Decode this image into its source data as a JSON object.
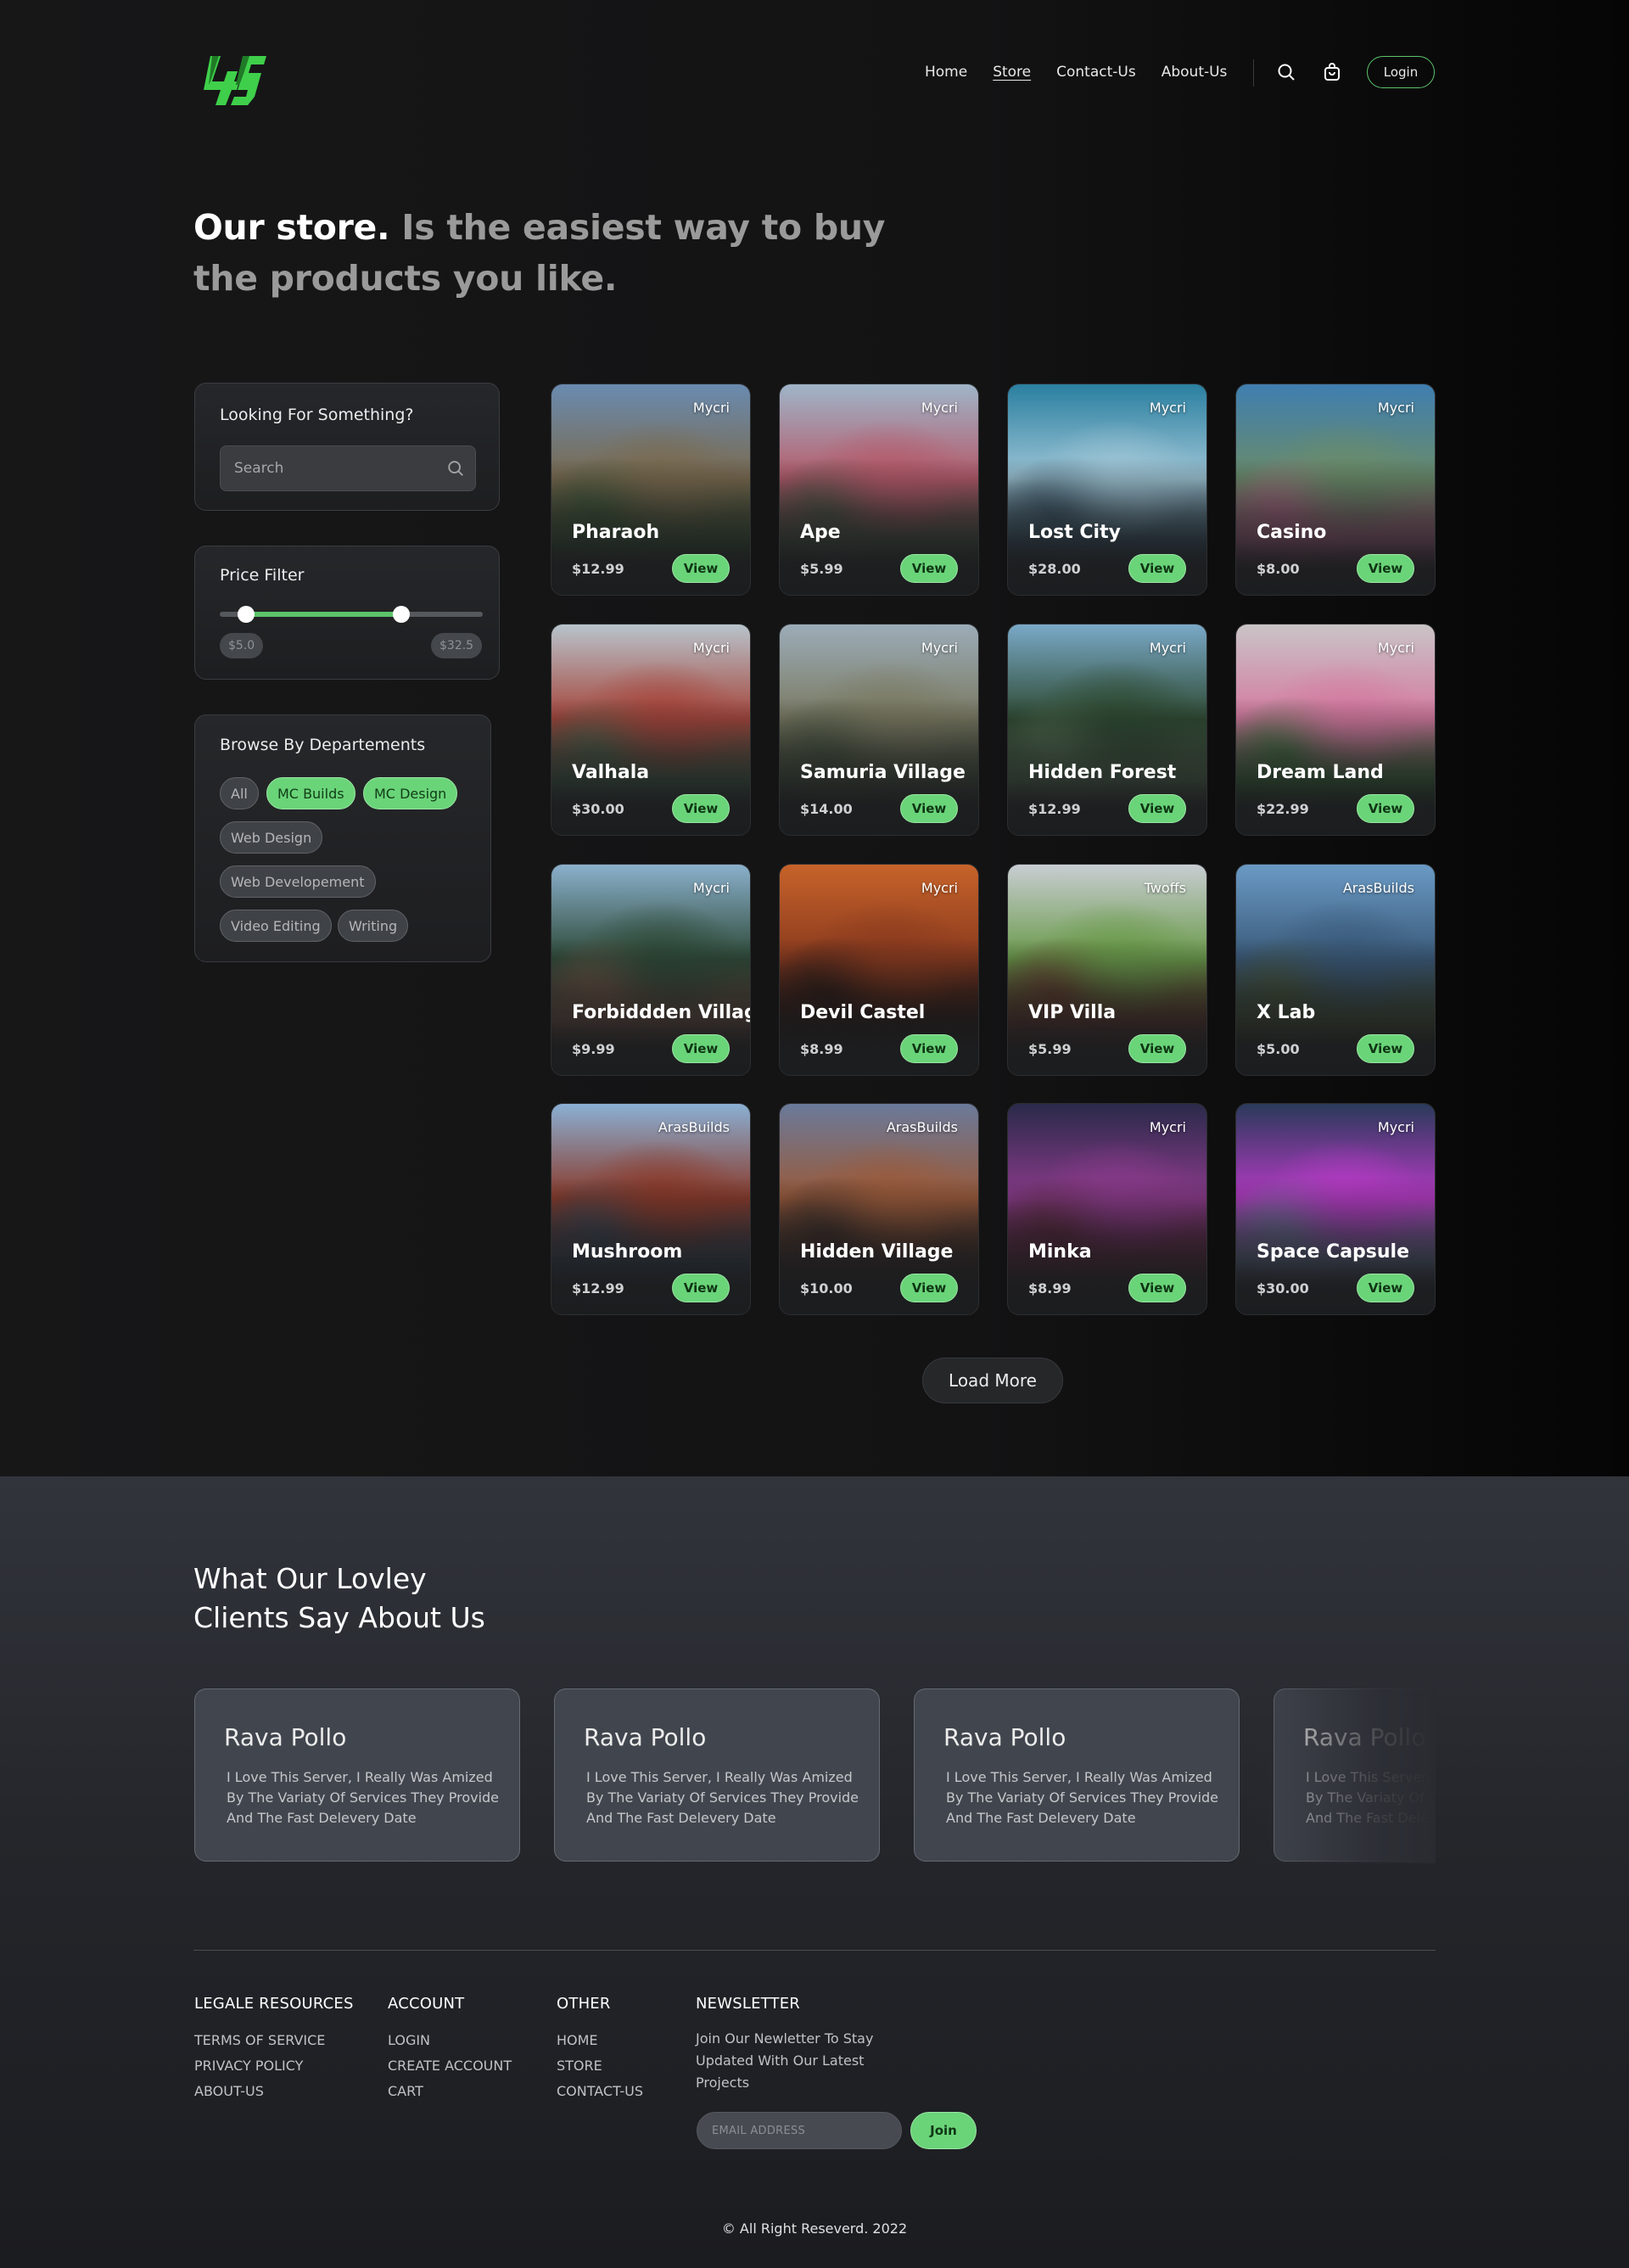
{
  "header": {
    "logo_text": "4S",
    "nav": [
      {
        "label": "Home",
        "active": false
      },
      {
        "label": "Store",
        "active": true
      },
      {
        "label": "Contact-Us",
        "active": false
      },
      {
        "label": "About-Us",
        "active": false
      }
    ],
    "search_icon": "search-icon",
    "cart_icon": "shopping-bag-icon",
    "login_label": "Login"
  },
  "hero": {
    "strong": "Our store.",
    "muted": "Is the easiest way to buy the products you like."
  },
  "sidebar": {
    "search": {
      "title": "Looking For Something?",
      "placeholder": "Search"
    },
    "price": {
      "title": "Price Filter",
      "min_label": "$5.0",
      "max_label": "$32.5",
      "range_low_fraction": 0.1,
      "range_high_fraction": 0.69
    },
    "departments": {
      "title": "Browse By Departements",
      "chips": [
        {
          "label": "All",
          "selected": false
        },
        {
          "label": "MC Builds",
          "selected": true
        },
        {
          "label": "MC Design",
          "selected": true
        },
        {
          "label": "Web Design",
          "selected": false
        },
        {
          "label": "Web Developement",
          "selected": false
        },
        {
          "label": "Video Editing",
          "selected": false
        },
        {
          "label": "Writing",
          "selected": false
        }
      ]
    }
  },
  "products": [
    {
      "name": "Pharaoh",
      "author": "Mycri",
      "price": "$12.99",
      "button": "View",
      "palette": [
        "#6a8bb0",
        "#7a6a4f",
        "#3c5a3a"
      ]
    },
    {
      "name": "Ape",
      "author": "Mycri",
      "price": "$5.99",
      "button": "View",
      "palette": [
        "#9fb5c9",
        "#b45a6a",
        "#4b5a48"
      ]
    },
    {
      "name": "Lost City",
      "author": "Mycri",
      "price": "$28.00",
      "button": "View",
      "palette": [
        "#2a7fa0",
        "#9ec5d6",
        "#3c5a6b"
      ]
    },
    {
      "name": "Casino",
      "author": "Mycri",
      "price": "$8.00",
      "button": "View",
      "palette": [
        "#3f7eb0",
        "#6a8c6a",
        "#b56a8a"
      ]
    },
    {
      "name": "Valhala",
      "author": "Mycri",
      "price": "$30.00",
      "button": "View",
      "palette": [
        "#b8c4cc",
        "#a5463c",
        "#4a6a52"
      ]
    },
    {
      "name": "Samuria Village",
      "author": "Mycri",
      "price": "$14.00",
      "button": "View",
      "palette": [
        "#9cacb8",
        "#7a7a62",
        "#4a5a44"
      ]
    },
    {
      "name": "Hidden Forest",
      "author": "Mycri",
      "price": "$12.99",
      "button": "View",
      "palette": [
        "#7aa9c8",
        "#2e4a32",
        "#5c7a5a"
      ]
    },
    {
      "name": "Dream Land",
      "author": "Mycri",
      "price": "$22.99",
      "button": "View",
      "palette": [
        "#c9c4c6",
        "#d47aa0",
        "#3f7a42"
      ]
    },
    {
      "name": "Forbiddden Village",
      "author": "Mycri",
      "price": "$9.99",
      "button": "View",
      "palette": [
        "#8bb0cc",
        "#2e4a38",
        "#7a5a4a"
      ]
    },
    {
      "name": "Devil Castel",
      "author": "Mycri",
      "price": "$8.99",
      "button": "View",
      "palette": [
        "#c7632a",
        "#8a3a1e",
        "#2a1a16"
      ]
    },
    {
      "name": "VIP Villa",
      "author": "Twoffs",
      "price": "$5.99",
      "button": "View",
      "palette": [
        "#c8cdd2",
        "#6a9a4a",
        "#6a3a2e"
      ]
    },
    {
      "name": "X Lab",
      "author": "ArasBuilds",
      "price": "$5.00",
      "button": "View",
      "palette": [
        "#6a9ac4",
        "#3a5a7a",
        "#4a5a3a"
      ]
    },
    {
      "name": "Mushroom",
      "author": "ArasBuilds",
      "price": "$12.99",
      "button": "View",
      "palette": [
        "#8ab0d4",
        "#8a3a2a",
        "#3a4a5a"
      ]
    },
    {
      "name": "Hidden Village",
      "author": "ArasBuilds",
      "price": "$10.00",
      "button": "View",
      "palette": [
        "#6a7a9a",
        "#9a5a3a",
        "#3a2e2a"
      ]
    },
    {
      "name": "Minka",
      "author": "Mycri",
      "price": "$8.99",
      "button": "View",
      "palette": [
        "#2a2a4a",
        "#8a3a8a",
        "#5a2a3a"
      ]
    },
    {
      "name": "Space Capsule",
      "author": "Mycri",
      "price": "$30.00",
      "button": "View",
      "palette": [
        "#2a3a5a",
        "#b43ac4",
        "#6a7a9a"
      ]
    }
  ],
  "load_more_label": "Load More",
  "testimonials": {
    "title_line1": "What Our Lovley",
    "title_line2": "Clients Say About Us",
    "items": [
      {
        "name": "Rava Pollo",
        "text": "I Love This Server, I Really Was Amized By The Variaty Of Services They Provide And The Fast Delevery Date"
      },
      {
        "name": "Rava Pollo",
        "text": "I Love This Server, I Really Was Amized By The Variaty Of Services They Provide And The Fast Delevery Date"
      },
      {
        "name": "Rava Pollo",
        "text": "I Love This Server, I Really Was Amized By The Variaty Of Services They Provide And The Fast Delevery Date"
      },
      {
        "name": "Rava Pollo",
        "text": "I Love This Server, I Really Was Amized By The Variaty Of Services They Provide And The Fast Delevery Date"
      }
    ]
  },
  "footer": {
    "legal": {
      "title": "LEGALE RESOURCES",
      "links": [
        "TERMS OF SERVICE",
        "PRIVACY POLICY",
        "ABOUT-US"
      ]
    },
    "account": {
      "title": "ACCOUNT",
      "links": [
        "LOGIN",
        "CREATE ACCOUNT",
        "CART"
      ]
    },
    "other": {
      "title": "OTHER",
      "links": [
        "HOME",
        "STORE",
        "CONTACT-US"
      ]
    },
    "newsletter": {
      "title": "NEWSLETTER",
      "text": "Join Our Newletter To Stay Updated With Our Latest Projects",
      "email_placeholder": "EMAIL ADDRESS",
      "join_label": "Join"
    },
    "copyright": "© All Right Reseverd. 2022"
  },
  "colors": {
    "accent": "#6ad479",
    "background": "#121213",
    "card": "#222325"
  }
}
